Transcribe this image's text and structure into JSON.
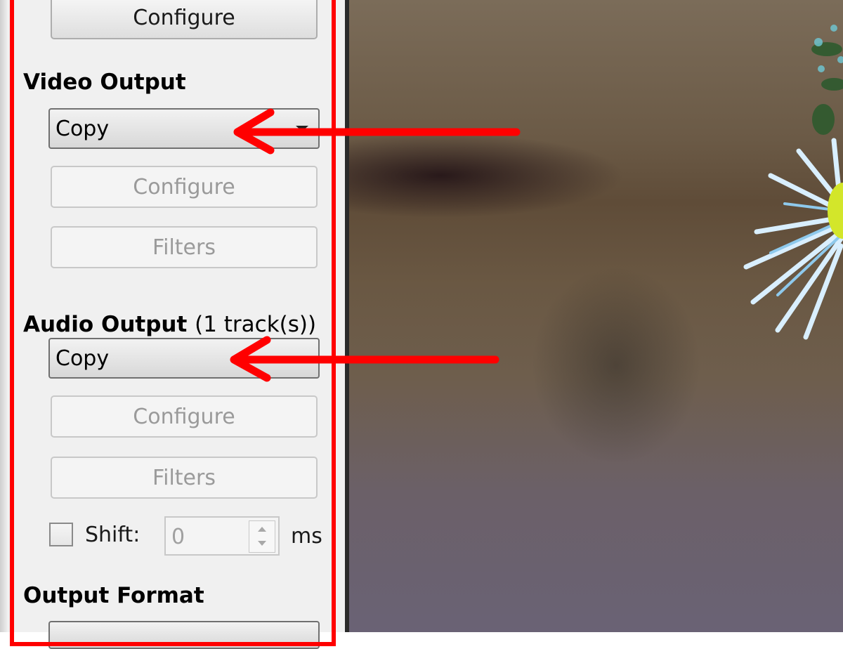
{
  "panel": {
    "top_configure_label": "Configure",
    "video_output": {
      "heading": "Video Output",
      "codec_value": "Copy",
      "configure_label": "Configure",
      "filters_label": "Filters"
    },
    "audio_output": {
      "heading": "Audio Output",
      "track_info": "(1 track(s))",
      "codec_value": "Copy",
      "configure_label": "Configure",
      "filters_label": "Filters",
      "shift_label": "Shift:",
      "shift_value": "0",
      "shift_unit": "ms"
    },
    "output_format": {
      "heading": "Output Format"
    }
  },
  "annotations": {
    "arrow_color": "#ff0000",
    "frame_color": "#ff0000"
  }
}
